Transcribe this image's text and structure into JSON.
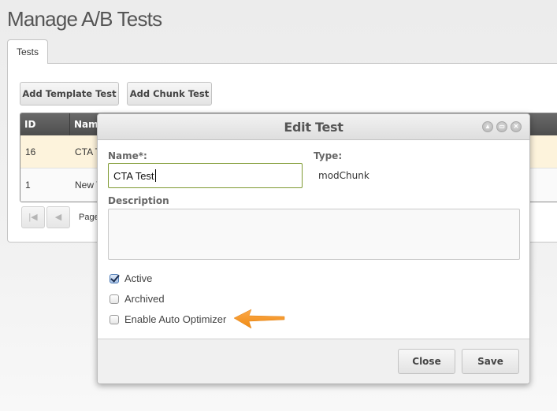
{
  "page": {
    "title": "Manage A/B Tests"
  },
  "tabs": [
    {
      "label": "Tests",
      "active": true
    }
  ],
  "toolbar": {
    "add_template_label": "Add Template Test",
    "add_chunk_label": "Add Chunk Test"
  },
  "grid": {
    "columns": [
      "ID",
      "Name"
    ],
    "rows": [
      {
        "id": "16",
        "name": "CTA Test",
        "selected": true
      },
      {
        "id": "1",
        "name": "New Test",
        "selected": false
      }
    ]
  },
  "pager": {
    "first_icon": "first-page-icon",
    "prev_icon": "prev-page-icon",
    "page_label": "Page"
  },
  "modal": {
    "title": "Edit Test",
    "controls": [
      "collapse-icon",
      "maximize-icon",
      "close-icon"
    ],
    "name_label": "Name*:",
    "name_value": "CTA Test",
    "type_label": "Type:",
    "type_value": "modChunk",
    "description_label": "Description",
    "description_value": "",
    "checkboxes": [
      {
        "label": "Active",
        "checked": true
      },
      {
        "label": "Archived",
        "checked": false
      },
      {
        "label": "Enable Auto Optimizer",
        "checked": false
      }
    ],
    "close_label": "Close",
    "save_label": "Save"
  },
  "annotation": {
    "arrow_color": "#f7931e"
  }
}
